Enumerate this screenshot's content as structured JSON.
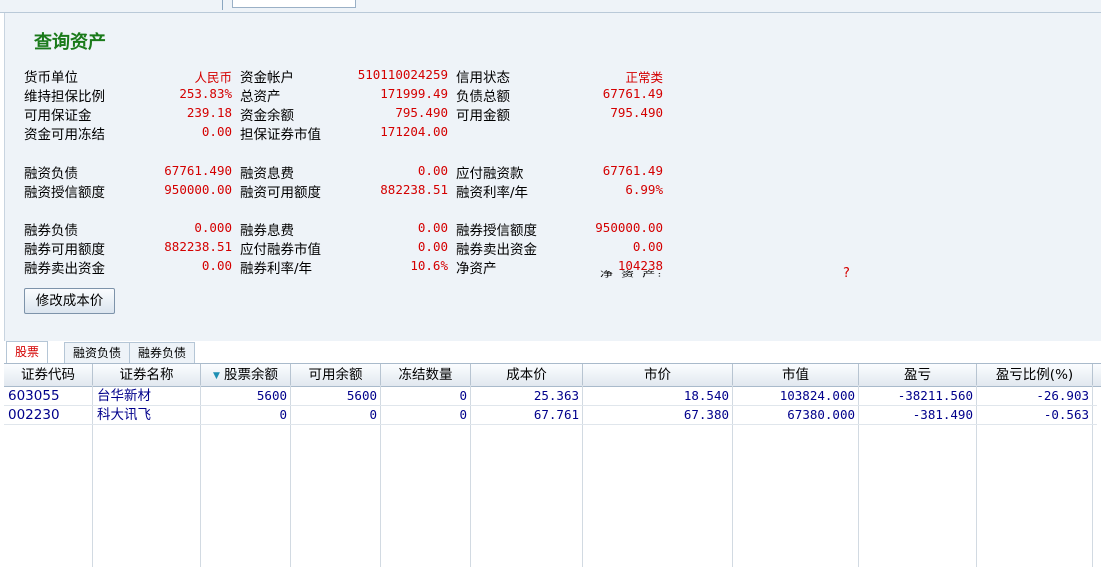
{
  "title": "查询资产",
  "fields": [
    [
      {
        "label": "货币单位",
        "value": "人民币"
      },
      {
        "label": "资金帐户",
        "value": "510110024259"
      },
      {
        "label": "信用状态",
        "value": "正常类"
      }
    ],
    [
      {
        "label": "维持担保比例",
        "value": "253.83%"
      },
      {
        "label": "总资产",
        "value": "171999.49"
      },
      {
        "label": "负债总额",
        "value": "67761.49"
      }
    ],
    [
      {
        "label": "可用保证金",
        "value": "239.18"
      },
      {
        "label": "资金余额",
        "value": "795.490"
      },
      {
        "label": "可用金额",
        "value": "795.490"
      }
    ],
    [
      {
        "label": "资金可用冻结",
        "value": "0.00"
      },
      {
        "label": "担保证券市值",
        "value": "171204.00"
      }
    ],
    [
      {
        "label": "融资负债",
        "value": "67761.490"
      },
      {
        "label": "融资息费",
        "value": "0.00"
      },
      {
        "label": "应付融资款",
        "value": "67761.49"
      }
    ],
    [
      {
        "label": "融资授信额度",
        "value": "950000.00"
      },
      {
        "label": "融资可用额度",
        "value": "882238.51"
      },
      {
        "label": "融资利率/年",
        "value": "6.99%"
      }
    ],
    [
      {
        "label": "融券负债",
        "value": "0.000"
      },
      {
        "label": "融券息费",
        "value": "0.00"
      },
      {
        "label": "融券授信额度",
        "value": "950000.00"
      }
    ],
    [
      {
        "label": "融券可用额度",
        "value": "882238.51"
      },
      {
        "label": "应付融券市值",
        "value": "0.00"
      },
      {
        "label": "融券卖出资金",
        "value": "0.00"
      }
    ],
    [
      {
        "label": "融券卖出资金",
        "value": "0.00"
      },
      {
        "label": "融券利率/年",
        "value": "10.6%"
      },
      {
        "label": "净资产",
        "value": "104238"
      }
    ]
  ],
  "overlap_text": "净 资 产:",
  "overlap_mark": "?",
  "modify_cost_button": "修改成本价",
  "tabs": [
    "股票",
    "融资负债",
    "融券负债"
  ],
  "active_tab": 0,
  "columns": [
    "证券代码",
    "证券名称",
    "股票余额",
    "可用余额",
    "冻结数量",
    "成本价",
    "市价",
    "市值",
    "盈亏",
    "盈亏比例(%)"
  ],
  "sorted_column_icon": "sort-down-triangle-icon",
  "rows": [
    [
      "603055",
      "台华新材",
      "5600",
      "5600",
      "0",
      "25.363",
      "18.540",
      "103824.000",
      "-38211.560",
      "-26.903"
    ],
    [
      "002230",
      "科大讯飞",
      "0",
      "0",
      "0",
      "67.761",
      "67.380",
      "67380.000",
      "-381.490",
      "-0.563"
    ]
  ]
}
